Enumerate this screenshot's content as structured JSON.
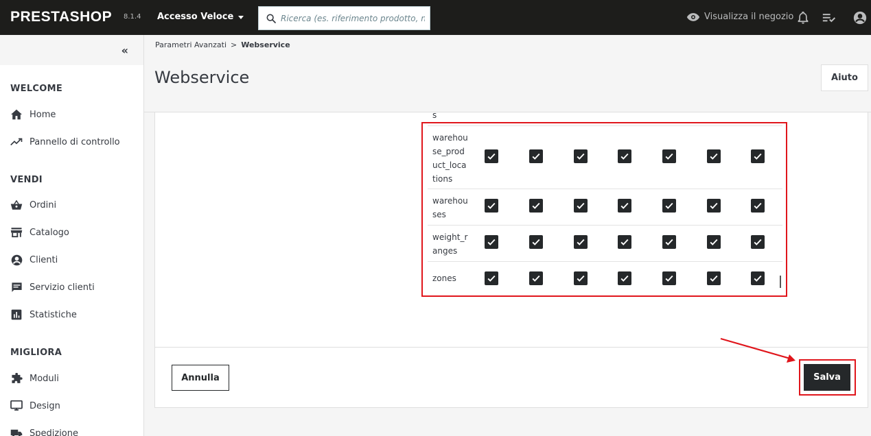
{
  "header": {
    "logo": "PRESTASHOP",
    "version": "8.1.4",
    "quick_access": "Accesso Veloce",
    "search_placeholder": "Ricerca (es. riferimento prodotto, nom",
    "view_shop": "Visualizza il negozio"
  },
  "sidebar": {
    "sections": [
      {
        "title": "WELCOME",
        "items": [
          {
            "label": "Home",
            "icon": "home-icon"
          },
          {
            "label": "Pannello di controllo",
            "icon": "trending-up-icon"
          }
        ]
      },
      {
        "title": "VENDI",
        "items": [
          {
            "label": "Ordini",
            "icon": "basket-icon"
          },
          {
            "label": "Catalogo",
            "icon": "store-icon"
          },
          {
            "label": "Clienti",
            "icon": "account-circle-icon"
          },
          {
            "label": "Servizio clienti",
            "icon": "chat-icon"
          },
          {
            "label": "Statistiche",
            "icon": "bar-chart-icon"
          }
        ]
      },
      {
        "title": "MIGLIORA",
        "items": [
          {
            "label": "Moduli",
            "icon": "puzzle-icon"
          },
          {
            "label": "Design",
            "icon": "monitor-icon"
          },
          {
            "label": "Spedizione",
            "icon": "truck-icon"
          }
        ]
      }
    ]
  },
  "breadcrumb": {
    "parent": "Parametri Avanzati",
    "separator": ">",
    "current": "Webservice"
  },
  "page": {
    "title": "Webservice",
    "help_button": "Aiuto"
  },
  "table": {
    "truncated_top_label": "s",
    "rows": [
      {
        "label_lines": [
          "warehou",
          "se_prod",
          "uct_loca",
          "tions"
        ],
        "checked": [
          true,
          true,
          true,
          true,
          true,
          true,
          true
        ]
      },
      {
        "label_lines": [
          "warehou",
          "ses"
        ],
        "checked": [
          true,
          true,
          true,
          true,
          true,
          true,
          true
        ]
      },
      {
        "label_lines": [
          "weight_r",
          "anges"
        ],
        "checked": [
          true,
          true,
          true,
          true,
          true,
          true,
          true
        ]
      },
      {
        "label_lines": [
          "zones"
        ],
        "checked": [
          true,
          true,
          true,
          true,
          true,
          true,
          true
        ]
      }
    ]
  },
  "footer": {
    "cancel_button": "Annulla",
    "save_button": "Salva"
  },
  "colors": {
    "header_bg": "#1d1d1b",
    "highlight": "#e0151b",
    "checkbox": "#25282a"
  }
}
